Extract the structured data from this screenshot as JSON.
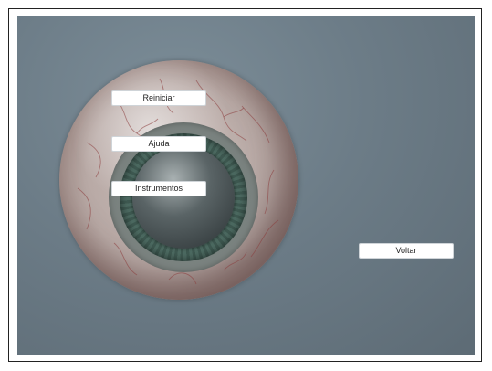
{
  "menu": {
    "restart_label": "Reiniciar",
    "help_label": "Ajuda",
    "instruments_label": "Instrumentos",
    "back_label": "Voltar"
  },
  "scene": {
    "object": "eyeball-3d-model",
    "background_color": "#6c7c87",
    "sclera_color": "#b8a9a5",
    "iris_color": "#4d6b62",
    "pupil_color": "#2a3133"
  }
}
